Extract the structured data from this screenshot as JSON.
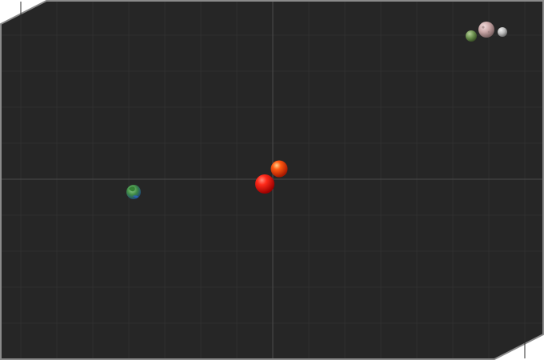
{
  "scene": {
    "colors": {
      "background": "#262626",
      "grid": "#2f2f2f",
      "axis": "#4a4a4a",
      "frame": "#8a8a8a"
    },
    "bodies": [
      {
        "name": "earth-planet-icon",
        "kind": "earth"
      },
      {
        "name": "red-star-icon",
        "kind": "red-star"
      },
      {
        "name": "orange-star-icon",
        "kind": "orange-star"
      },
      {
        "name": "pink-moon-icon",
        "kind": "pink-moon"
      },
      {
        "name": "green-moon-icon",
        "kind": "green-moon"
      },
      {
        "name": "grey-moon-icon",
        "kind": "grey-moon"
      }
    ]
  }
}
